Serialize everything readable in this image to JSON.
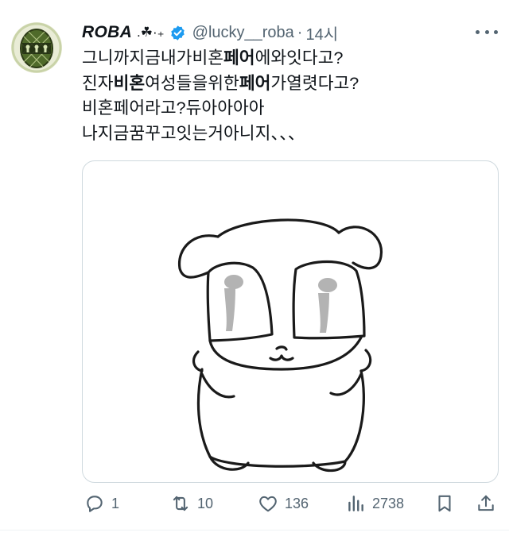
{
  "tweet": {
    "display_name": "ROBA",
    "name_decoration": ".☘︎·₊",
    "handle": "@lucky__roba",
    "separator": "·",
    "time": "14시",
    "lines": [
      {
        "parts": [
          {
            "t": "그니까지금내가비혼",
            "b": false
          },
          {
            "t": "페어",
            "b": true
          },
          {
            "t": "에와잇다고?",
            "b": false
          }
        ]
      },
      {
        "parts": [
          {
            "t": "진자",
            "b": false
          },
          {
            "t": "비혼",
            "b": true
          },
          {
            "t": "여성들을위한",
            "b": false
          },
          {
            "t": "페어",
            "b": true
          },
          {
            "t": "가열렷다고?",
            "b": false
          }
        ]
      },
      {
        "parts": [
          {
            "t": "비혼페어라고?듀아아아아",
            "b": false
          }
        ]
      },
      {
        "parts": [
          {
            "t": "나지금꿈꾸고잇는거아니지、、、",
            "b": false
          }
        ]
      }
    ]
  },
  "actions": {
    "replies": "1",
    "retweets": "10",
    "likes": "136",
    "views": "2738"
  },
  "icons": {
    "verified": "verified-badge-icon",
    "more": "more-options-icon",
    "reply": "reply-icon",
    "retweet": "retweet-icon",
    "like": "heart-icon",
    "views": "views-chart-icon",
    "bookmark": "bookmark-icon",
    "share": "share-icon"
  },
  "colors": {
    "verified_blue": "#1d9bf0",
    "muted": "#536471",
    "text": "#0f1419",
    "border": "#cfd9de"
  }
}
